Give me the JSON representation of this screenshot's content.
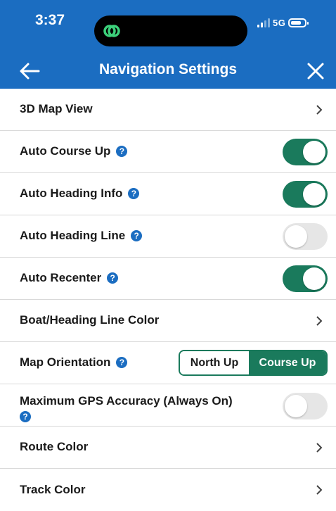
{
  "status_bar": {
    "time": "3:37",
    "network": "5G",
    "battery_level": 0.8,
    "pill_icon": "link-rings-icon"
  },
  "header": {
    "title": "Navigation Settings",
    "back_icon": "arrow-left-icon",
    "close_icon": "close-icon"
  },
  "colors": {
    "header_bg": "#1b6dc1",
    "accent_green": "#1a7a5c",
    "help_blue": "#1b6dc1"
  },
  "settings": {
    "map_3d": {
      "label": "3D Map View"
    },
    "auto_course_up": {
      "label": "Auto Course Up",
      "enabled": true
    },
    "auto_heading_info": {
      "label": "Auto Heading Info",
      "enabled": true
    },
    "auto_heading_line": {
      "label": "Auto Heading Line",
      "enabled": false
    },
    "auto_recenter": {
      "label": "Auto Recenter",
      "enabled": true
    },
    "boat_heading_line_color": {
      "label": "Boat/Heading Line Color"
    },
    "map_orientation": {
      "label": "Map Orientation",
      "options": [
        "North Up",
        "Course Up"
      ],
      "selected": "Course Up"
    },
    "max_gps_accuracy": {
      "label": "Maximum GPS Accuracy (Always On)",
      "enabled": false
    },
    "route_color": {
      "label": "Route Color"
    },
    "track_color": {
      "label": "Track Color"
    }
  },
  "help_glyph": "?"
}
